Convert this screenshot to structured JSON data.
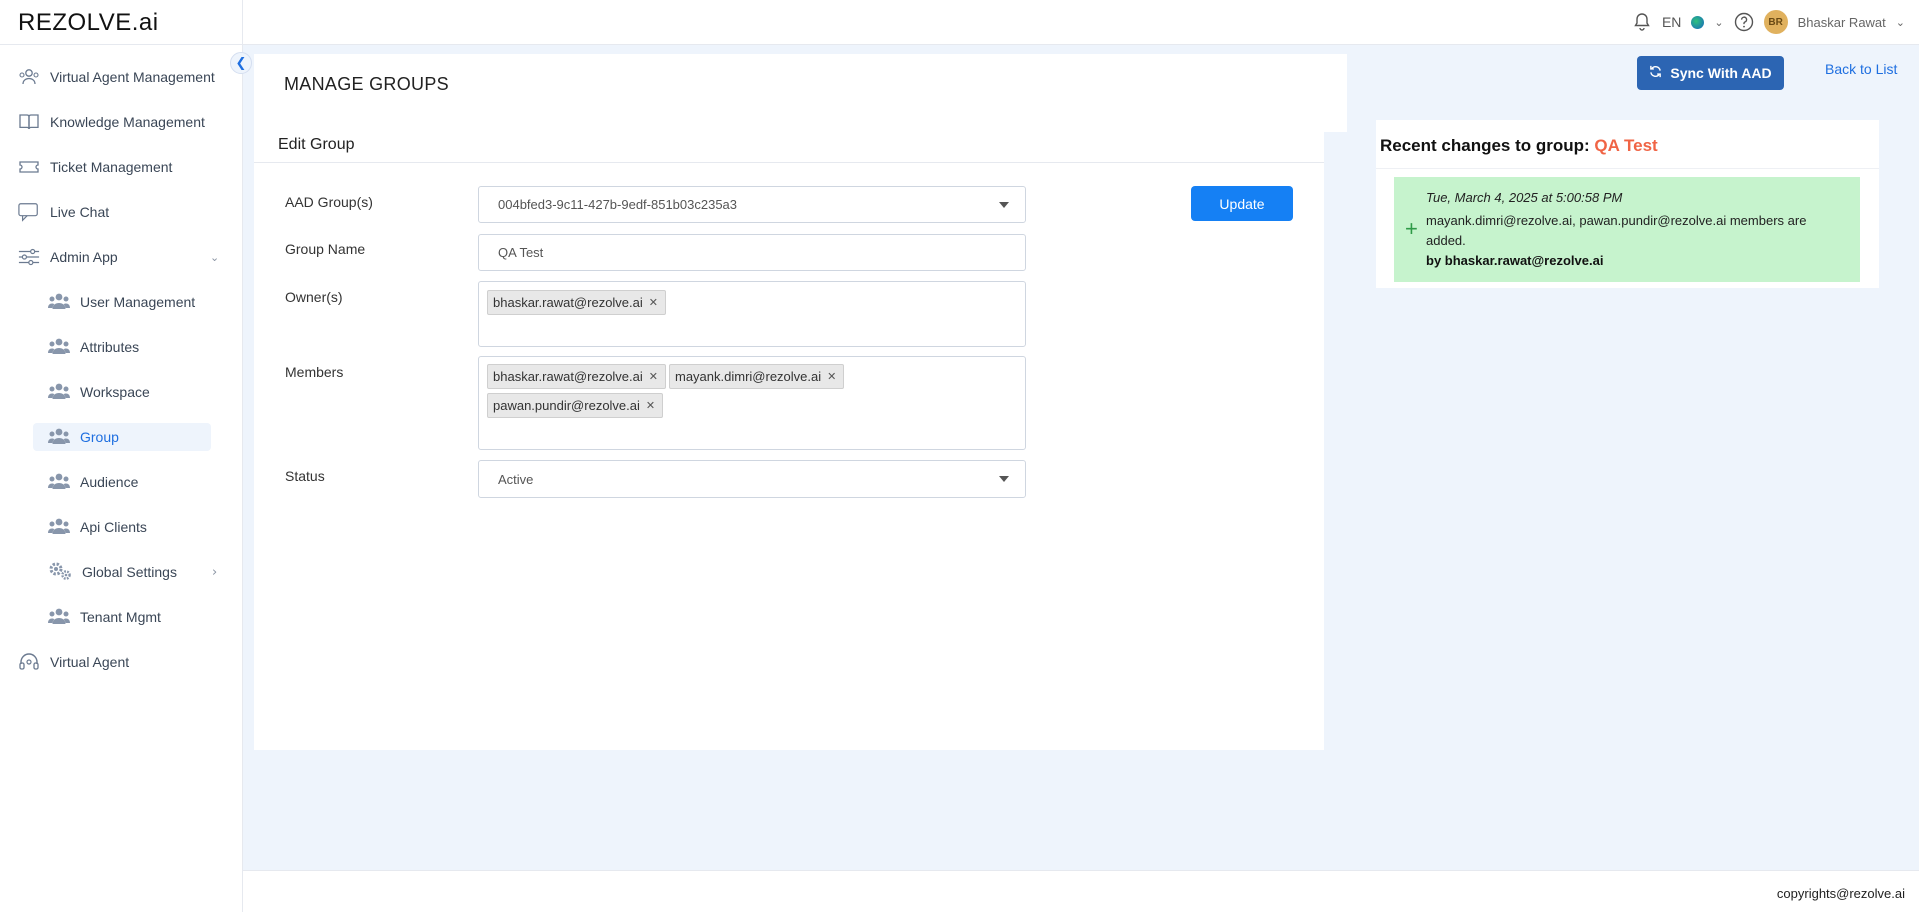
{
  "app": {
    "logo_text": "REZOLVE.ai"
  },
  "topbar": {
    "language": "EN",
    "avatar_initials": "BR",
    "user_name": "Bhaskar Rawat"
  },
  "sidebar": {
    "items": [
      {
        "label": "Virtual Agent Management",
        "icon": "agents-icon"
      },
      {
        "label": "Knowledge Management",
        "icon": "book-icon"
      },
      {
        "label": "Ticket Management",
        "icon": "ticket-icon"
      },
      {
        "label": "Live Chat",
        "icon": "chat-icon"
      },
      {
        "label": "Admin App",
        "icon": "sliders-icon"
      }
    ],
    "admin_sub_items": [
      {
        "label": "User Management"
      },
      {
        "label": "Attributes"
      },
      {
        "label": "Workspace"
      },
      {
        "label": "Group",
        "active": true
      },
      {
        "label": "Audience"
      },
      {
        "label": "Api Clients"
      },
      {
        "label": "Global Settings"
      },
      {
        "label": "Tenant Mgmt"
      }
    ],
    "bottom_item": {
      "label": "Virtual Agent",
      "icon": "headset-icon"
    }
  },
  "page": {
    "title": "MANAGE GROUPS",
    "sync_button": "Sync With AAD",
    "back_link": "Back to List"
  },
  "edit_group": {
    "title": "Edit Group",
    "update_button": "Update",
    "fields": {
      "aad_group_label": "AAD Group(s)",
      "aad_group_value": "004bfed3-9c11-427b-9edf-851b03c235a3",
      "group_name_label": "Group Name",
      "group_name_value": "QA Test",
      "owners_label": "Owner(s)",
      "owners": [
        "bhaskar.rawat@rezolve.ai"
      ],
      "members_label": "Members",
      "members": [
        "bhaskar.rawat@rezolve.ai",
        "mayank.dimri@rezolve.ai",
        "pawan.pundir@rezolve.ai"
      ],
      "status_label": "Status",
      "status_value": "Active"
    }
  },
  "recent_changes": {
    "title_prefix": "Recent changes to group:",
    "group_name": "QA Test",
    "entries": [
      {
        "timestamp": "Tue, March 4, 2025 at 5:00:58 PM",
        "message": "mayank.dimri@rezolve.ai, pawan.pundir@rezolve.ai members are added.",
        "by": "by bhaskar.rawat@rezolve.ai",
        "card_color": "#c6f3cd"
      }
    ]
  },
  "footer": {
    "copyright": "copyrights@rezolve.ai"
  },
  "colors": {
    "accent": "#1f6fe0",
    "sync_button": "#2c65b3",
    "update_button": "#1580f4",
    "group_highlight": "#f06445",
    "background": "#eef4fc"
  }
}
